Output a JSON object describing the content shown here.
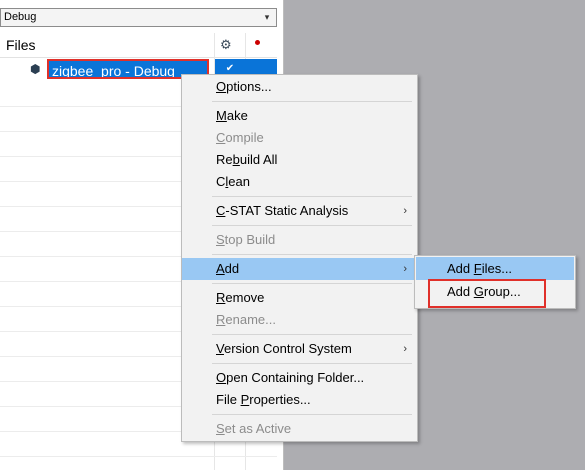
{
  "workspace": {
    "config_value": "Debug",
    "files_title": "Files",
    "project": {
      "label": "zigbee_pro - Debug",
      "check": "✔"
    }
  },
  "context_menu": {
    "items": [
      {
        "label": "Options...",
        "mnemonic": "O",
        "enabled": true
      },
      {
        "label": "Make",
        "mnemonic": "M",
        "enabled": true
      },
      {
        "label": "Compile",
        "mnemonic": "C",
        "enabled": false
      },
      {
        "label": "Rebuild All",
        "mnemonic": "b",
        "enabled": true
      },
      {
        "label": "Clean",
        "mnemonic": "l",
        "enabled": true
      },
      {
        "label": "C-STAT Static Analysis",
        "mnemonic": "C",
        "enabled": true,
        "submenu": true
      },
      {
        "label": "Stop Build",
        "mnemonic": "S",
        "enabled": false
      },
      {
        "label": "Add",
        "mnemonic": "A",
        "enabled": true,
        "submenu": true,
        "highlighted": true
      },
      {
        "label": "Remove",
        "mnemonic": "R",
        "enabled": true
      },
      {
        "label": "Rename...",
        "mnemonic": "R",
        "enabled": false
      },
      {
        "label": "Version Control System",
        "mnemonic": "V",
        "enabled": true,
        "submenu": true
      },
      {
        "label": "Open Containing Folder...",
        "mnemonic": "O",
        "enabled": true
      },
      {
        "label": "File Properties...",
        "mnemonic": "P",
        "enabled": true
      },
      {
        "label": "Set as Active",
        "mnemonic": "S",
        "enabled": false
      }
    ]
  },
  "add_submenu": {
    "items": [
      {
        "label": "Add Files...",
        "mnemonic": "F",
        "highlighted": true
      },
      {
        "label": "Add Group...",
        "mnemonic": "G",
        "highlighted": false
      }
    ]
  },
  "colors": {
    "selection_blue": "#0a74d8",
    "menu_highlight": "#99c8f3",
    "annotation_red": "#e0302a",
    "background_gray": "#adadb1"
  },
  "icons": {
    "caret": "▾",
    "gear": "⚙",
    "project": "⬢",
    "submenu_arrow": "›"
  }
}
